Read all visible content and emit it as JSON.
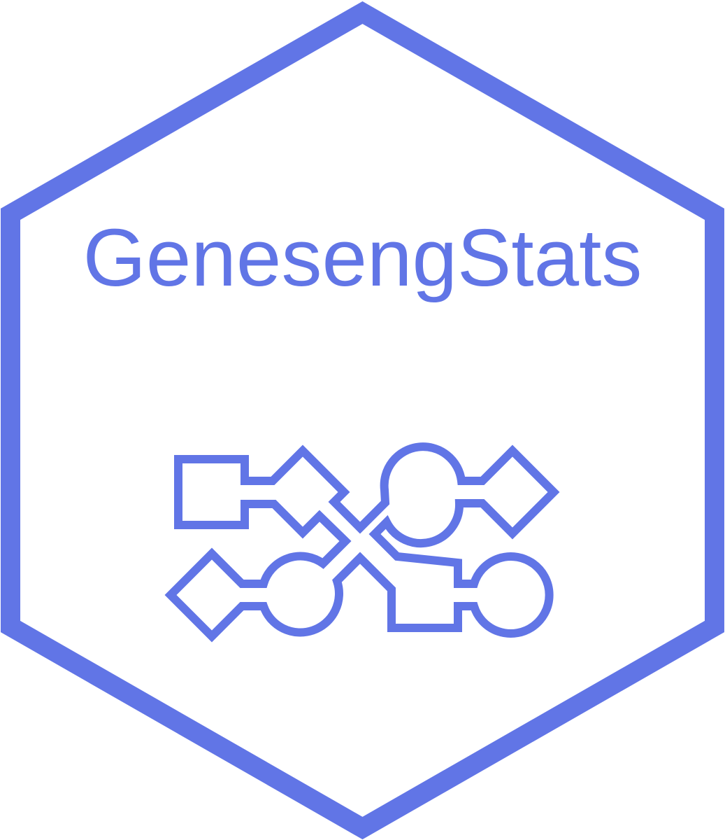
{
  "logo": {
    "title": "GenesengStats",
    "brand_color": "#6175E6",
    "background_color": "#FFFFFF",
    "icon": "gene-network-puzzle-icon"
  }
}
